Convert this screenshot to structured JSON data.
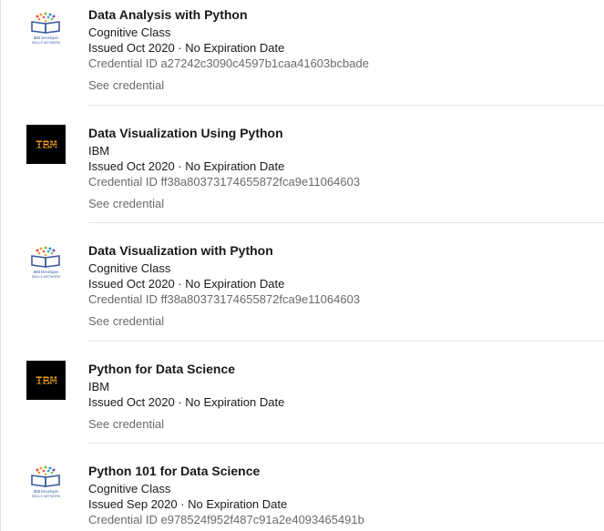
{
  "credentials": [
    {
      "title": "Data Analysis with Python",
      "issuer": "Cognitive Class",
      "issued": "Issued Oct 2020 · No Expiration Date",
      "credential_id": "Credential ID a27242c3090c4597b1caa41603bcbade",
      "see_credential": "See credential",
      "logo": "ibm-developer-skills-network-logo",
      "logo_text_1": "IBM Developer",
      "logo_text_2": "SKILLS NETWORK"
    },
    {
      "title": "Data Visualization Using Python",
      "issuer": "IBM",
      "issued": "Issued Oct 2020 · No Expiration Date",
      "credential_id": "Credential ID ff38a80373174655872fca9e11064603",
      "see_credential": "See credential",
      "logo": "ibm-logo"
    },
    {
      "title": "Data Visualization with Python",
      "issuer": "Cognitive Class",
      "issued": "Issued Oct 2020 · No Expiration Date",
      "credential_id": "Credential ID ff38a80373174655872fca9e11064603",
      "see_credential": "See credential",
      "logo": "ibm-developer-skills-network-logo",
      "logo_text_1": "IBM Developer",
      "logo_text_2": "SKILLS NETWORK"
    },
    {
      "title": "Python for Data Science",
      "issuer": "IBM",
      "issued": "Issued Oct 2020 · No Expiration Date",
      "see_credential": "See credential",
      "logo": "ibm-logo"
    },
    {
      "title": "Python 101 for Data Science",
      "issuer": "Cognitive Class",
      "issued": "Issued Sep 2020 · No Expiration Date",
      "credential_id": "Credential ID e978524f952f487c91a2e4093465491b",
      "logo": "ibm-developer-skills-network-logo",
      "logo_text_1": "IBM Developer",
      "logo_text_2": "SKILLS NETWORK"
    }
  ],
  "ibm_logo_text": "IBM",
  "colors": {
    "ibm_logo_bg": "#000000",
    "skills_blue": "#3a5ba0",
    "divider": "#e6e6e6"
  }
}
